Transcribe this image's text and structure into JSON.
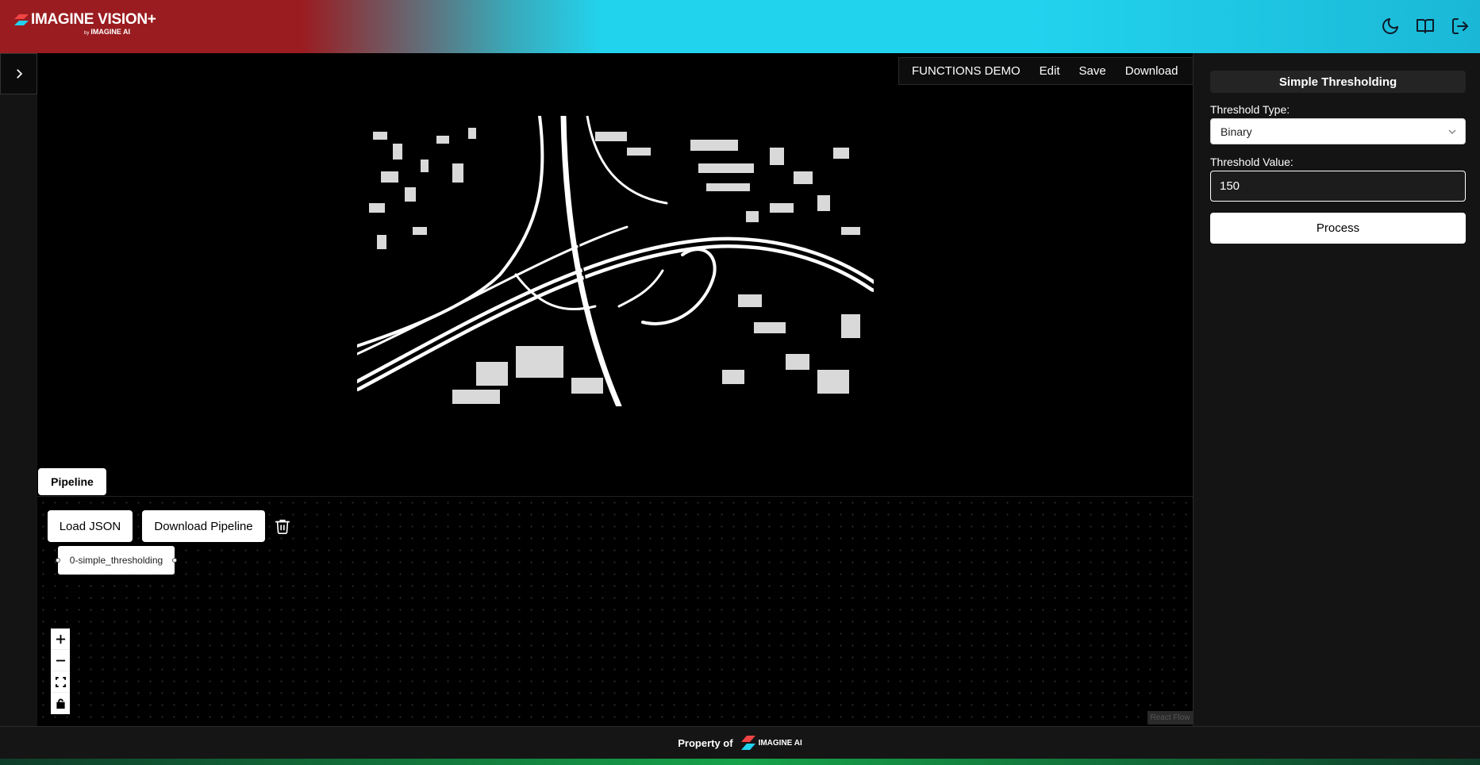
{
  "header": {
    "brand": "IMAGINE VISION+",
    "brand_by": "by",
    "brand_company": "IMAGINE AI",
    "icons": [
      "moon-icon",
      "book-icon",
      "logout-icon"
    ]
  },
  "menu": {
    "title": "FUNCTIONS DEMO",
    "edit": "Edit",
    "save": "Save",
    "download": "Download"
  },
  "pipeline": {
    "tab": "Pipeline",
    "load_json": "Load JSON",
    "download_pipeline": "Download Pipeline",
    "node_label": "0-simple_thresholding",
    "attribution": "React Flow"
  },
  "panel": {
    "title": "Simple Thresholding",
    "threshold_type_label": "Threshold Type:",
    "threshold_type_value": "Binary",
    "threshold_value_label": "Threshold Value:",
    "threshold_value": "150",
    "process_label": "Process"
  },
  "footer": {
    "text": "Property of",
    "company": "IMAGINE AI"
  },
  "colors": {
    "header_red": "#9a1c20",
    "header_cyan": "#22d3ee",
    "background": "#000000",
    "panel": "#141414"
  }
}
